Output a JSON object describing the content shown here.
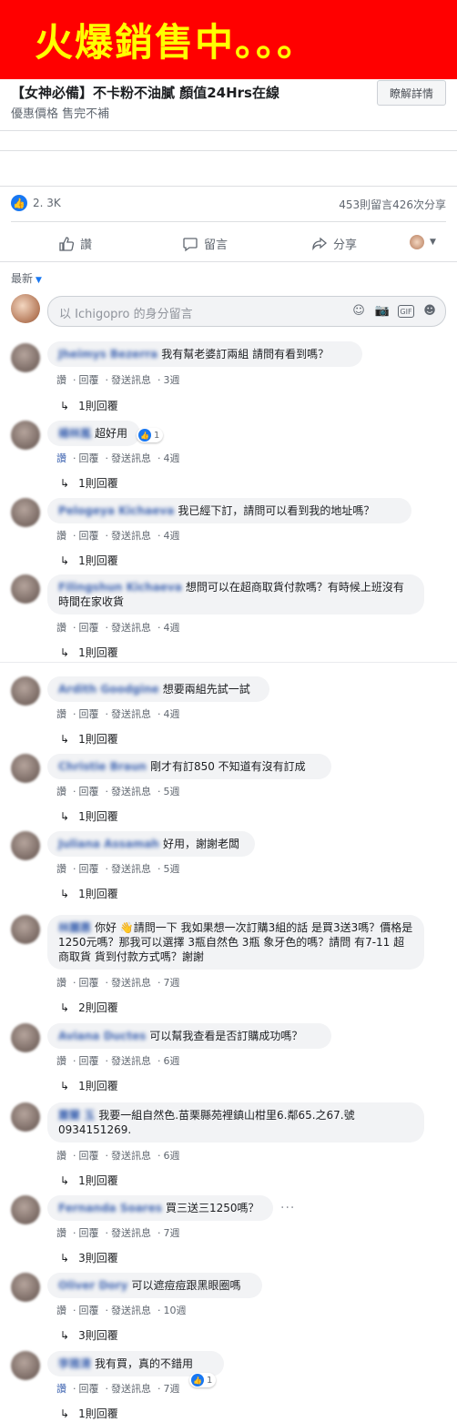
{
  "banner": {
    "text": "火爆銷售中。。。"
  },
  "ad": {
    "title": "【女神必備】不卡粉不油膩 顏值24Hrs在線",
    "subtitle": "優惠價格 售完不補",
    "learn_more": "瞭解詳情"
  },
  "stats": {
    "likes": "2. 3K",
    "counts": "453則留言426次分享"
  },
  "actions": {
    "like": "讚",
    "comment": "留言",
    "share": "分享"
  },
  "sort": {
    "label": "最新"
  },
  "composer": {
    "placeholder": "以 Ichigopro 的身分留言"
  },
  "comment_actions": {
    "like": "讚",
    "reply": "回覆",
    "message": "發送訊息"
  },
  "comments": [
    {
      "name": "Jheimys Bezerra",
      "text": "我有幫老婆訂兩組 請問有看到嗎？",
      "time": "3週",
      "replies": "1則回覆"
    },
    {
      "name": "楊林嵐",
      "text": "超好用",
      "time": "4週",
      "replies": "1則回覆",
      "reactions": "1"
    },
    {
      "name": "Pelogeya Kichaeva",
      "text": "我已經下訂，請問可以看到我的地址嗎？",
      "time": "4週",
      "replies": "1則回覆"
    },
    {
      "name": "Filingshun Kichaeva",
      "text": "想問可以在超商取貨付款嗎？有時候上班沒有時間在家收貨",
      "time": "4週",
      "replies": "1則回覆"
    },
    {
      "name": "Ardith Goodgine",
      "text": "想要兩組先試一試",
      "time": "4週",
      "replies": "1則回覆"
    },
    {
      "name": "Christie Braun",
      "text": "剛才有訂850 不知道有沒有訂成",
      "time": "5週",
      "replies": "1則回覆"
    },
    {
      "name": "Juliana Assamah",
      "text": "好用，謝謝老闆",
      "time": "5週",
      "replies": "1則回覆"
    },
    {
      "name": "林麗惠",
      "text": "你好 👋請問一下 我如果想一次訂購3組的話 是買3送3嗎？價格是1250元嗎？那我可以選擇 3瓶自然色 3瓶 象牙色的嗎？請問 有7-11 超商取貨 貨到付款方式嗎？謝謝",
      "time": "7週",
      "replies": "2則回覆"
    },
    {
      "name": "Aviana Ductes",
      "text": "可以幫我查看是否訂購成功嗎？",
      "time": "6週",
      "replies": "1則回覆"
    },
    {
      "name": "蕭蘭 玉",
      "text": "我要一組自然色.苗栗縣苑裡鎮山柑里6.鄰65.之67.號 0934151269.",
      "time": "6週",
      "replies": "1則回覆"
    },
    {
      "name": "Fernanda Soares",
      "text": "買三送三1250嗎？",
      "time": "7週",
      "replies": "3則回覆"
    },
    {
      "name": "Oliver Dory",
      "text": "可以遮痘痘跟黑眼圈嗎",
      "time": "10週",
      "replies": "3則回覆"
    },
    {
      "name": "李雅清",
      "text": "我有買，真的不錯用",
      "time": "7週",
      "replies": "1則回覆",
      "reactions": "1"
    }
  ],
  "colors": {
    "banner_bg": "#ff0000",
    "banner_text": "#ffff00",
    "link": "#4267b2",
    "accent": "#1877f2"
  }
}
